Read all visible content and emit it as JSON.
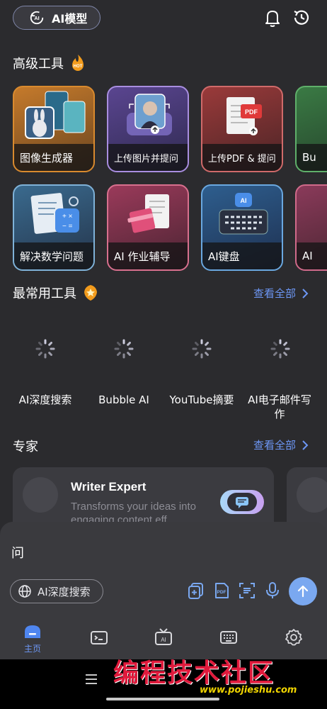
{
  "top": {
    "model_label": "AI模型"
  },
  "advanced": {
    "title": "高级工具",
    "badge": "HOT",
    "row1": [
      "图像生成器",
      "上传图片并提问",
      "上传PDF & 提问",
      "Bu"
    ],
    "row2": [
      "解决数学问题",
      "AI 作业辅导",
      "AI键盘",
      "AI"
    ]
  },
  "common": {
    "title": "最常用工具",
    "see_all": "查看全部",
    "tools": [
      "AI深度搜索",
      "Bubble AI",
      "YouTube摘要",
      "AI电子邮件写作"
    ]
  },
  "experts": {
    "title": "专家",
    "see_all": "查看全部",
    "card": {
      "name": "Writer Expert",
      "desc": "Transforms your ideas into engaging content eff..."
    }
  },
  "input": {
    "text": "问",
    "deep_search": "AI深度搜索"
  },
  "nav": {
    "home": "主页"
  },
  "watermark": {
    "text": "编程技术社区",
    "url": "www.pojieshu.com"
  },
  "colors": {
    "accent": "#6d97f5",
    "send": "#7aa8f0",
    "background": "#2b2b2e"
  }
}
